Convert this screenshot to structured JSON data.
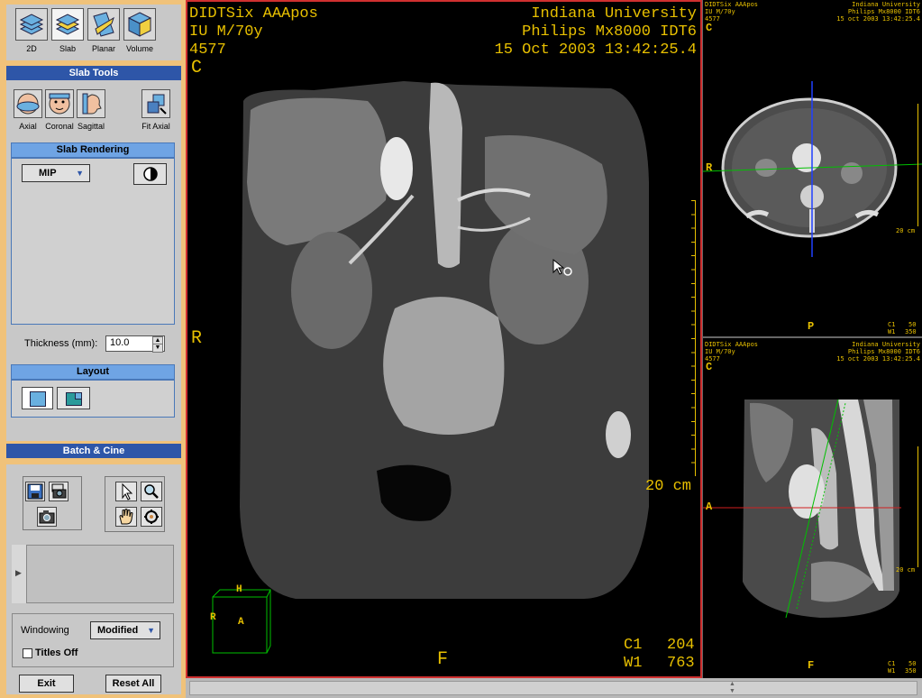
{
  "toolbar": {
    "modes": [
      {
        "label": "2D",
        "icon": "stack-2d-icon"
      },
      {
        "label": "Slab",
        "icon": "stack-slab-icon"
      },
      {
        "label": "Planar",
        "icon": "planar-icon"
      },
      {
        "label": "Volume",
        "icon": "volume-cube-icon"
      }
    ]
  },
  "slab_tools": {
    "title": "Slab Tools",
    "views": [
      {
        "label": "Axial",
        "icon": "head-axial-icon"
      },
      {
        "label": "Coronal",
        "icon": "head-coronal-icon"
      },
      {
        "label": "Sagittal",
        "icon": "head-sagittal-icon"
      }
    ],
    "fit_axial_label": "Fit Axial",
    "rendering_title": "Slab Rendering",
    "rendering_mode": "MIP",
    "thickness_label": "Thickness (mm):",
    "thickness_value": "10.0",
    "layout_title": "Layout",
    "batch_title": "Batch & Cine"
  },
  "bottom_panel": {
    "windowing_label": "Windowing",
    "windowing_value": "Modified",
    "titles_off_label": "Titles Off",
    "exit_label": "Exit",
    "reset_all_label": "Reset All"
  },
  "main_view": {
    "patient_name": "DIDTSix AAApos",
    "patient_info": "IU M/70y",
    "patient_id": "4577",
    "institution": "Indiana University",
    "scanner": "Philips Mx8000 IDT6",
    "datetime": "15 Oct 2003 13:42:25.4",
    "orient_top": "C",
    "orient_left": "R",
    "orient_bottom": "F",
    "scale_label": "20 cm",
    "c_label": "C1",
    "c_value": "204",
    "w_label": "W1",
    "w_value": "763",
    "cube_h": "H",
    "cube_r": "R",
    "cube_a": "A"
  },
  "axial_view": {
    "patient_name": "DIDTSix AAApos",
    "patient_info": "IU M/70y",
    "patient_id": "4577",
    "institution": "Indiana University",
    "scanner": "Philips Mx8000 IDT6",
    "datetime": "15 oct 2003 13:42:25.4",
    "orient_top": "C",
    "orient_left": "R",
    "orient_bottom": "P",
    "scale_label": "20 cm",
    "c_label": "C1",
    "c_value": "50",
    "w_label": "W1",
    "w_value": "350"
  },
  "sagittal_view": {
    "patient_name": "DIDTSix AAApos",
    "patient_info": "IU M/70y",
    "patient_id": "4577",
    "institution": "Indiana University",
    "scanner": "Philips Mx8000 IDT6",
    "datetime": "15 oct 2003 13:42:25.4",
    "orient_top": "C",
    "orient_left": "A",
    "orient_bottom": "F",
    "scale_label": "20 cm",
    "c_label": "C1",
    "c_value": "50",
    "w_label": "W1",
    "w_value": "350"
  },
  "colors": {
    "overlay_text": "#e8c000",
    "active_border": "#d03030",
    "panel_accent": "#2e56a8"
  }
}
